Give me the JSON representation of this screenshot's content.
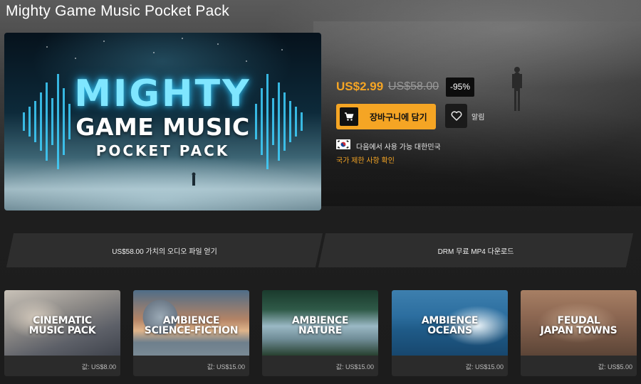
{
  "product": {
    "title": "Mighty Game Music Pocket Pack",
    "hero_art": {
      "line1": "MIGHTY",
      "line2": "GAME MUSIC",
      "line3": "POCKET PACK"
    }
  },
  "purchase": {
    "price_now": "US$2.99",
    "price_old": "US$58.00",
    "discount": "-95%",
    "cart_label": "장바구니에 담기",
    "cart_icon": "shopping-cart-icon",
    "wishlist_icon": "heart-icon",
    "wishlist_label": "알림",
    "flag_icon": "south-korea-flag-icon",
    "availability": "다음에서 사용 가능 대한민국",
    "restrictions_link": "국가 제한 사항 확인",
    "accent_color": "#f5a524"
  },
  "features": [
    {
      "label": "US$58.00 가치의 오디오 파일 얻기"
    },
    {
      "label": "DRM 무료 MP4 다운로드"
    }
  ],
  "packs": [
    {
      "title": "CINEMATIC\nMUSIC PACK",
      "price": "값: US$8.00"
    },
    {
      "title": "AMBIENCE\nSCIENCE-FICTION",
      "price": "값: US$15.00"
    },
    {
      "title": "AMBIENCE\nNATURE",
      "price": "값: US$15.00"
    },
    {
      "title": "AMBIENCE\nOCEANS",
      "price": "값: US$15.00"
    },
    {
      "title": "FEUDAL\nJAPAN TOWNS",
      "price": "값: US$5.00"
    }
  ]
}
